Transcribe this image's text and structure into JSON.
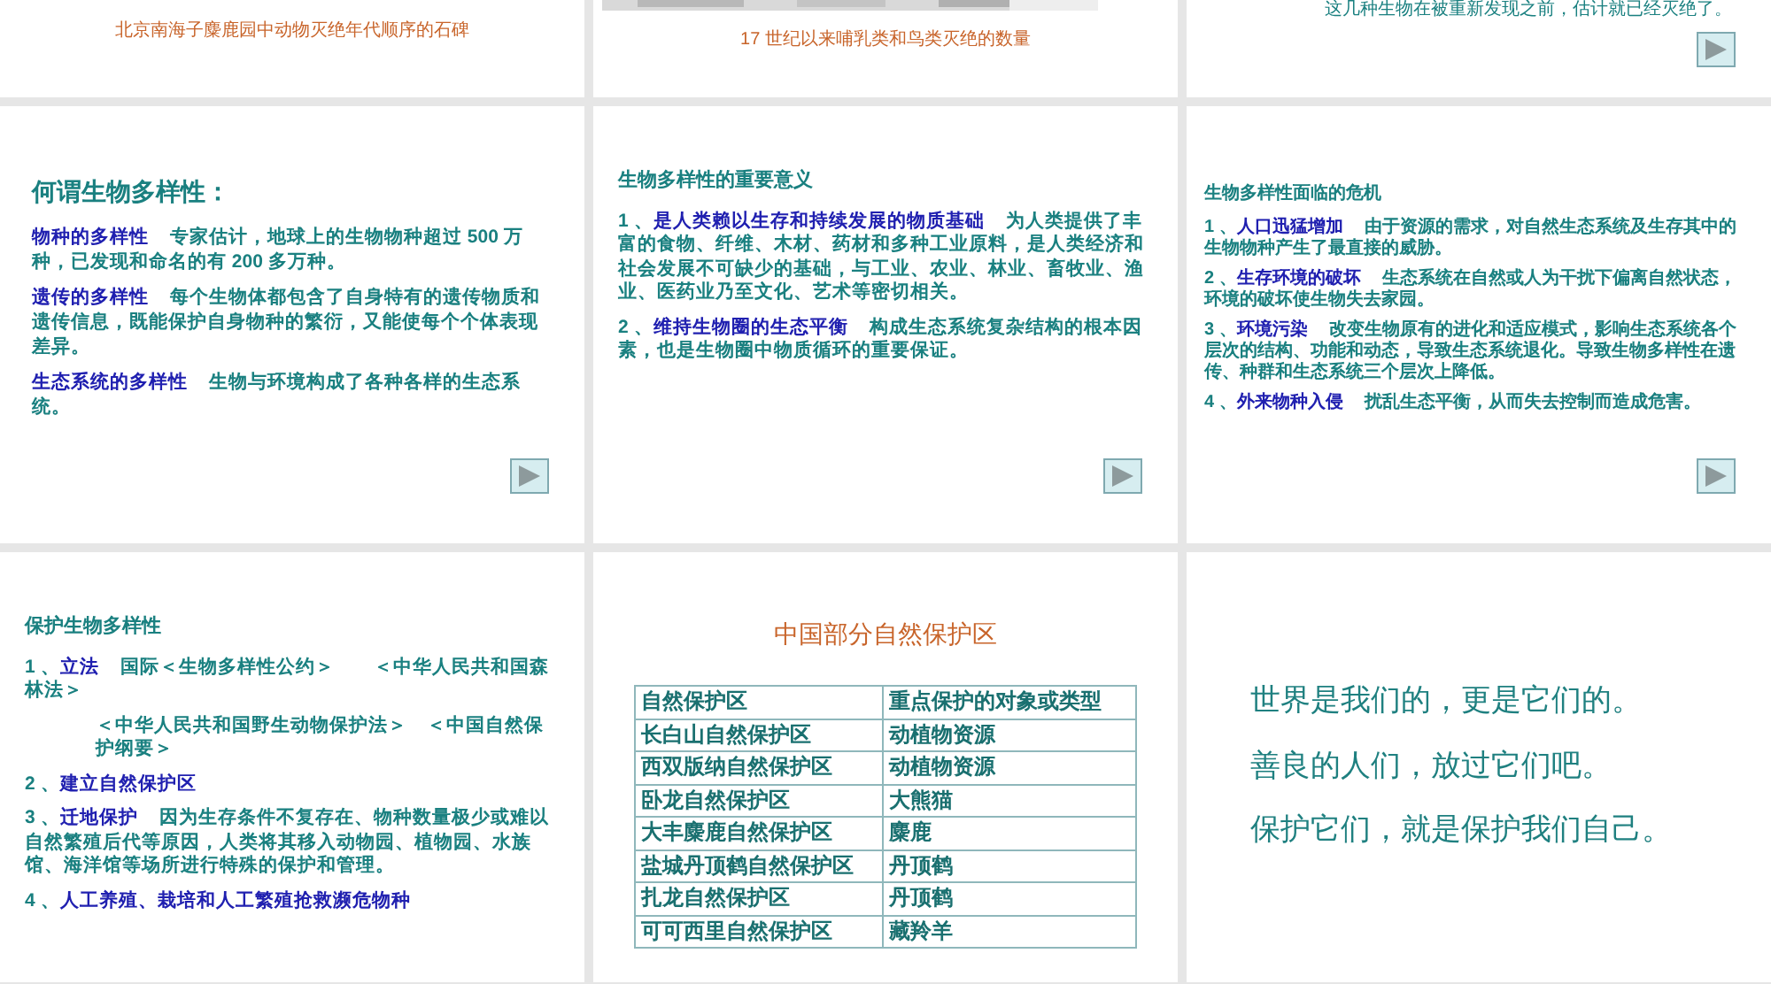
{
  "slides": [
    {
      "kind": "caption",
      "caption": "北京南海子麋鹿园中动物灭绝年代顺序的石碑",
      "nav_button": false
    },
    {
      "kind": "picture_caption",
      "caption": "17 世纪以来哺乳类和鸟类灭绝的数量",
      "nav_button": false
    },
    {
      "kind": "note",
      "text": "这几种生物在被重新发现之前，估计就已经灭绝了。",
      "nav_button": true
    },
    {
      "kind": "headed_list",
      "title": "何谓生物多样性：",
      "items": [
        {
          "label": "物种的多样性",
          "text": "专家估计，地球上的生物物种超过 500 万种，已发现和命名的有 200 多万种。"
        },
        {
          "label": "遗传的多样性",
          "text": "每个生物体都包含了自身特有的遗传物质和遗传信息，既能保护自身物种的繁衍，又能使每个个体表现差异。"
        },
        {
          "label": "生态系统的多样性",
          "text": "生物与环境构成了各种各样的生态系统。"
        }
      ],
      "nav_button": true
    },
    {
      "kind": "list",
      "title": "生物多样性的重要意义",
      "items": [
        {
          "num": "1 、",
          "label": "是人类赖以生存和持续发展的物质基础",
          "text": "为人类提供了丰富的食物、纤维、木材、药材和多种工业原料，是人类经济和社会发展不可缺少的基础，与工业、农业、林业、畜牧业、渔业、医药业乃至文化、艺术等密切相关。"
        },
        {
          "num": "2 、",
          "label": "维持生物圈的生态平衡",
          "text": "构成生态系统复杂结构的根本因素，也是生物圈中物质循环的重要保证。"
        }
      ],
      "nav_button": true
    },
    {
      "kind": "compact_list",
      "title": "生物多样性面临的危机",
      "items": [
        {
          "num": "1 、",
          "label": "人口迅猛增加",
          "text": "由于资源的需求，对自然生态系统及生存其中的生物物种产生了最直接的威胁。"
        },
        {
          "num": "2 、",
          "label": "生存环境的破坏",
          "text": "生态系统在自然或人为干扰下偏离自然状态，环境的破坏使生物失去家园。"
        },
        {
          "num": "3 、",
          "label": "环境污染",
          "text": "改变生物原有的进化和适应模式，影响生态系统各个层次的结构、功能和动态，导致生态系统退化。导致生物多样性在遗传、种群和生态系统三个层次上降低。"
        },
        {
          "num": "4 、",
          "label": "外来物种入侵",
          "text": "扰乱生态平衡，从而失去控制而造成危害。"
        }
      ],
      "nav_button": true
    },
    {
      "kind": "list",
      "title": "保护生物多样性",
      "items": [
        {
          "num": "1 、",
          "label": "立法",
          "text": "国际＜生物多样性公约＞　　＜中华人民共和国森林法＞"
        },
        {
          "text": "＜中华人民共和国野生动物保护法＞　＜中国自然保护纲要＞"
        },
        {
          "num": "2 、",
          "label": "建立自然保护区"
        },
        {
          "num": "3 、",
          "label": "迁地保护",
          "text": "因为生存条件不复存在、物种数量极少或难以自然繁殖后代等原因，人类将其移入动物园、植物园、水族馆、海洋馆等场所进行特殊的保护和管理。"
        },
        {
          "num": "4 、",
          "label": "人工养殖、栽培和人工繁殖抢救濒危物种"
        }
      ],
      "nav_button": false
    },
    {
      "kind": "table",
      "title": "中国部分自然保护区",
      "columns": [
        "自然保护区",
        "重点保护的对象或类型"
      ],
      "rows": [
        [
          "长白山自然保护区",
          "动植物资源"
        ],
        [
          "西双版纳自然保护区",
          "动植物资源"
        ],
        [
          "卧龙自然保护区",
          "大熊猫"
        ],
        [
          "大丰麋鹿自然保护区",
          "麋鹿"
        ],
        [
          "盐城丹顶鹤自然保护区",
          "丹顶鹤"
        ],
        [
          "扎龙自然保护区",
          "丹顶鹤"
        ],
        [
          "可可西里自然保护区",
          "藏羚羊"
        ]
      ],
      "nav_button": false
    },
    {
      "kind": "statements",
      "lines": [
        "世界是我们的，更是它们的。",
        "善良的人们，放过它们吧。",
        "保护它们，就是保护我们自己。"
      ],
      "nav_button": false
    }
  ]
}
